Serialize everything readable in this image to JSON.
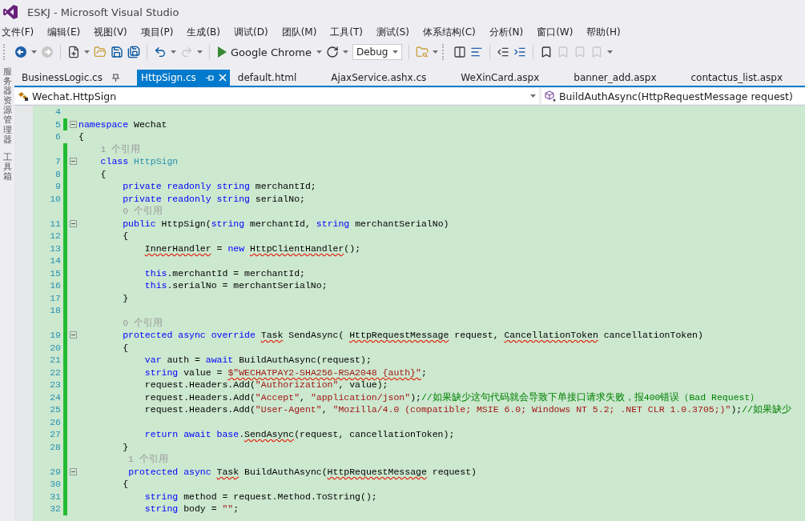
{
  "window": {
    "title": "ESKJ - Microsoft Visual Studio"
  },
  "menu": [
    "文件(F)",
    "编辑(E)",
    "视图(V)",
    "项目(P)",
    "生成(B)",
    "调试(D)",
    "团队(M)",
    "工具(T)",
    "测试(S)",
    "体系结构(C)",
    "分析(N)",
    "窗口(W)",
    "帮助(H)"
  ],
  "toolbar": {
    "run_target": "Google Chrome",
    "configuration": "Debug"
  },
  "side_tabs": [
    "服务器资源管理器",
    "工具箱"
  ],
  "tabs": [
    {
      "label": "BusinessLogic.cs",
      "selected": false,
      "pinned": true
    },
    {
      "label": "HttpSign.cs",
      "selected": true,
      "pinned": false
    },
    {
      "label": "default.html",
      "selected": false,
      "pinned": false
    },
    {
      "label": "AjaxService.ashx.cs",
      "selected": false,
      "pinned": false
    },
    {
      "label": "WeXinCard.aspx",
      "selected": false,
      "pinned": false
    },
    {
      "label": "banner_add.aspx",
      "selected": false,
      "pinned": false
    },
    {
      "label": "contactus_list.aspx",
      "selected": false,
      "pinned": false
    }
  ],
  "navigation": {
    "type_scope": "Wechat.HttpSign",
    "member": "BuildAuthAsync(HttpRequestMessage request)"
  },
  "lines": [
    {
      "kind": "code",
      "number": "4",
      "changed": false,
      "fold": false
    },
    {
      "kind": "code",
      "number": "5",
      "changed": true,
      "fold": true,
      "tokens": [
        {
          "kind": "kw",
          "text": "namespace",
          "error": false
        },
        {
          "kind": "plain",
          "text": " Wechat",
          "error": false
        }
      ]
    },
    {
      "kind": "code",
      "number": "6",
      "changed": false,
      "fold": false,
      "tokens": [
        {
          "kind": "plain",
          "text": "{",
          "error": false
        }
      ]
    },
    {
      "kind": "codelens",
      "changed": true,
      "text": "    1 个引用"
    },
    {
      "kind": "code",
      "number": "7",
      "changed": true,
      "fold": true,
      "tokens": [
        {
          "kind": "kw",
          "text": "    class",
          "error": false
        },
        {
          "kind": "type",
          "text": " HttpSign",
          "error": false
        }
      ]
    },
    {
      "kind": "code",
      "number": "8",
      "changed": true,
      "fold": false,
      "tokens": [
        {
          "kind": "plain",
          "text": "    {",
          "error": false
        }
      ]
    },
    {
      "kind": "code",
      "number": "9",
      "changed": true,
      "fold": false,
      "tokens": [
        {
          "kind": "kw",
          "text": "        private readonly string",
          "error": false
        },
        {
          "kind": "plain",
          "text": " merchantId;",
          "error": false
        }
      ]
    },
    {
      "kind": "code",
      "number": "10",
      "changed": true,
      "fold": false,
      "tokens": [
        {
          "kind": "kw",
          "text": "        private readonly string",
          "error": false
        },
        {
          "kind": "plain",
          "text": " serialNo;",
          "error": false
        }
      ]
    },
    {
      "kind": "codelens",
      "changed": true,
      "text": "        0 个引用"
    },
    {
      "kind": "code",
      "number": "11",
      "changed": true,
      "fold": true,
      "tokens": [
        {
          "kind": "kw",
          "text": "        public",
          "error": false
        },
        {
          "kind": "plain",
          "text": " HttpSign(",
          "error": false
        },
        {
          "kind": "kw",
          "text": "string",
          "error": false
        },
        {
          "kind": "plain",
          "text": " merchantId, ",
          "error": false
        },
        {
          "kind": "kw",
          "text": "string",
          "error": false
        },
        {
          "kind": "plain",
          "text": " merchantSerialNo)",
          "error": false
        }
      ]
    },
    {
      "kind": "code",
      "number": "12",
      "changed": true,
      "fold": false,
      "tokens": [
        {
          "kind": "plain",
          "text": "        {",
          "error": false
        }
      ]
    },
    {
      "kind": "code",
      "number": "13",
      "changed": true,
      "fold": false,
      "tokens": [
        {
          "kind": "plain",
          "text": "            InnerHandler",
          "error": true
        },
        {
          "kind": "plain",
          "text": " = ",
          "error": false
        },
        {
          "kind": "kw",
          "text": "new",
          "error": false
        },
        {
          "kind": "plain",
          "text": " HttpClientHandler",
          "error": true
        },
        {
          "kind": "plain",
          "text": "();",
          "error": false
        }
      ]
    },
    {
      "kind": "code",
      "number": "14",
      "changed": true,
      "fold": false
    },
    {
      "kind": "code",
      "number": "15",
      "changed": true,
      "fold": false,
      "tokens": [
        {
          "kind": "kw",
          "text": "            this",
          "error": false
        },
        {
          "kind": "plain",
          "text": ".merchantId = merchantId;",
          "error": false
        }
      ]
    },
    {
      "kind": "code",
      "number": "16",
      "changed": true,
      "fold": false,
      "tokens": [
        {
          "kind": "kw",
          "text": "            this",
          "error": false
        },
        {
          "kind": "plain",
          "text": ".serialNo = merchantSerialNo;",
          "error": false
        }
      ]
    },
    {
      "kind": "code",
      "number": "17",
      "changed": true,
      "fold": false,
      "tokens": [
        {
          "kind": "plain",
          "text": "        }",
          "error": false
        }
      ]
    },
    {
      "kind": "code",
      "number": "18",
      "changed": true,
      "fold": false
    },
    {
      "kind": "codelens",
      "changed": true,
      "text": "        0 个引用"
    },
    {
      "kind": "code",
      "number": "19",
      "changed": true,
      "fold": true,
      "tokens": [
        {
          "kind": "kw",
          "text": "        protected async override",
          "error": false
        },
        {
          "kind": "plain",
          "text": " Task",
          "error": true
        },
        {
          "kind": "plain",
          "text": " SendAsync( ",
          "error": false
        },
        {
          "kind": "plain",
          "text": "HttpRequestMessage",
          "error": true
        },
        {
          "kind": "plain",
          "text": " request, ",
          "error": false
        },
        {
          "kind": "plain",
          "text": "CancellationToken",
          "error": true
        },
        {
          "kind": "plain",
          "text": " cancellationToken)",
          "error": false
        }
      ]
    },
    {
      "kind": "code",
      "number": "20",
      "changed": true,
      "fold": false,
      "tokens": [
        {
          "kind": "plain",
          "text": "        {",
          "error": false
        }
      ]
    },
    {
      "kind": "code",
      "number": "21",
      "changed": true,
      "fold": false,
      "tokens": [
        {
          "kind": "kw",
          "text": "            var",
          "error": false
        },
        {
          "kind": "plain",
          "text": " auth = ",
          "error": false
        },
        {
          "kind": "kw",
          "text": "await",
          "error": false
        },
        {
          "kind": "plain",
          "text": " BuildAuthAsync(request);",
          "error": false
        }
      ]
    },
    {
      "kind": "code",
      "number": "22",
      "changed": true,
      "fold": false,
      "tokens": [
        {
          "kind": "kw",
          "text": "            string",
          "error": false
        },
        {
          "kind": "plain",
          "text": " value = ",
          "error": false
        },
        {
          "kind": "str",
          "text": "$\"WECHATPAY2-SHA256-RSA2048 {auth}\"",
          "error": true
        },
        {
          "kind": "plain",
          "text": ";",
          "error": false
        }
      ]
    },
    {
      "kind": "code",
      "number": "23",
      "changed": true,
      "fold": false,
      "tokens": [
        {
          "kind": "plain",
          "text": "            request.Headers.Add(",
          "error": false
        },
        {
          "kind": "str",
          "text": "\"Authorization\"",
          "error": false
        },
        {
          "kind": "plain",
          "text": ", value);",
          "error": false
        }
      ]
    },
    {
      "kind": "code",
      "number": "24",
      "changed": true,
      "fold": false,
      "tokens": [
        {
          "kind": "plain",
          "text": "            request.Headers.Add(",
          "error": false
        },
        {
          "kind": "str",
          "text": "\"Accept\"",
          "error": false
        },
        {
          "kind": "plain",
          "text": ", ",
          "error": false
        },
        {
          "kind": "str",
          "text": "\"application/json\"",
          "error": false
        },
        {
          "kind": "plain",
          "text": ");",
          "error": false
        },
        {
          "kind": "comment",
          "text": "//如果缺少这句代码就会导致下单接口请求失败，报400错误（Bad Request）",
          "error": false
        }
      ]
    },
    {
      "kind": "code",
      "number": "25",
      "changed": true,
      "fold": false,
      "tokens": [
        {
          "kind": "plain",
          "text": "            request.Headers.Add(",
          "error": false
        },
        {
          "kind": "str",
          "text": "\"User-Agent\"",
          "error": false
        },
        {
          "kind": "plain",
          "text": ", ",
          "error": false
        },
        {
          "kind": "str",
          "text": "\"Mozilla/4.0 (compatible; MSIE 6.0; Windows NT 5.2; .NET CLR 1.0.3705;)\"",
          "error": false
        },
        {
          "kind": "plain",
          "text": ");",
          "error": false
        },
        {
          "kind": "comment",
          "text": "//如果缺少",
          "error": false
        }
      ]
    },
    {
      "kind": "code",
      "number": "26",
      "changed": true,
      "fold": false
    },
    {
      "kind": "code",
      "number": "27",
      "changed": true,
      "fold": false,
      "tokens": [
        {
          "kind": "kw",
          "text": "            return await base",
          "error": false
        },
        {
          "kind": "plain",
          "text": ".",
          "error": false
        },
        {
          "kind": "plain",
          "text": "SendAsync",
          "error": true
        },
        {
          "kind": "plain",
          "text": "(request, cancellationToken);",
          "error": false
        }
      ]
    },
    {
      "kind": "code",
      "number": "28",
      "changed": true,
      "fold": false,
      "tokens": [
        {
          "kind": "plain",
          "text": "        }",
          "error": false
        }
      ]
    },
    {
      "kind": "codelens",
      "changed": true,
      "text": "         1 个引用"
    },
    {
      "kind": "code",
      "number": "29",
      "changed": true,
      "fold": true,
      "tokens": [
        {
          "kind": "kw",
          "text": "         protected async",
          "error": false
        },
        {
          "kind": "plain",
          "text": " Task",
          "error": true
        },
        {
          "kind": "plain",
          "text": " BuildAuthAsync(",
          "error": false
        },
        {
          "kind": "plain",
          "text": "HttpRequestMessage",
          "error": true
        },
        {
          "kind": "plain",
          "text": " request)",
          "error": false
        }
      ]
    },
    {
      "kind": "code",
      "number": "30",
      "changed": true,
      "fold": false,
      "tokens": [
        {
          "kind": "plain",
          "text": "        {",
          "error": false
        }
      ]
    },
    {
      "kind": "code",
      "number": "31",
      "changed": true,
      "fold": false,
      "tokens": [
        {
          "kind": "kw",
          "text": "            string",
          "error": false
        },
        {
          "kind": "plain",
          "text": " method = request.Method.ToString();",
          "error": false
        }
      ]
    },
    {
      "kind": "code",
      "number": "32",
      "changed": true,
      "fold": false,
      "tokens": [
        {
          "kind": "kw",
          "text": "            string",
          "error": false
        },
        {
          "kind": "plain",
          "text": " body = ",
          "error": false
        },
        {
          "kind": "str",
          "text": "\"\"",
          "error": false
        },
        {
          "kind": "plain",
          "text": ";",
          "error": false
        }
      ]
    }
  ]
}
